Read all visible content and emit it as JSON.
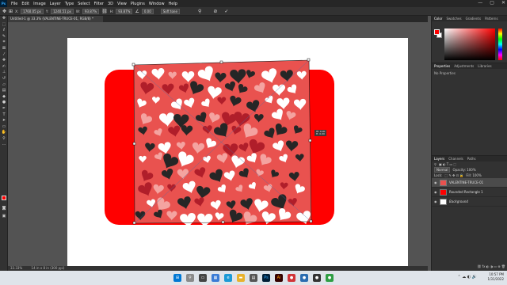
{
  "app": {
    "logo": "Ps",
    "menu": [
      "File",
      "Edit",
      "Image",
      "Layer",
      "Type",
      "Select",
      "Filter",
      "3D",
      "View",
      "Plugins",
      "Window",
      "Help"
    ],
    "window_controls": [
      "—",
      "▢",
      "✕"
    ]
  },
  "options_bar": {
    "x_label": "X:",
    "x_value": "1760.05 px",
    "y_label": "Y:",
    "y_value": "1240.51 px",
    "w_label": "W:",
    "w_value": "93.87%",
    "h_label": "H:",
    "h_value": "93.87%",
    "angle_value": "0.00",
    "interp_label": "Soft tone",
    "cancel_icon": "cancel-icon",
    "commit_icon": "check-icon"
  },
  "document": {
    "tab_title": "Untitled-1 @ 33.3% (VALENTINE-TRUCE-01, RGB/8) *",
    "zoom_status": "33.33%",
    "doc_status": "14 in x 8 in (300 ppi)",
    "transform_readout": "W: 0.00\nH: 0.00"
  },
  "panels": {
    "color_tabs": [
      "Color",
      "Swatches",
      "Gradients",
      "Patterns"
    ],
    "props_tabs": [
      "Properties",
      "Adjustments",
      "Libraries"
    ],
    "props_text": "No Properties",
    "layers_tabs": [
      "Layers",
      "Channels",
      "Paths"
    ],
    "blend_mode": "Normal",
    "opacity_label": "Opacity: 100%",
    "fill_label": "Fill: 100%",
    "lock_label": "Lock:",
    "layers": [
      {
        "name": "VALENTINE-TRUCE-01",
        "selected": true
      },
      {
        "name": "Rounded Rectangle 1",
        "selected": false
      },
      {
        "name": "Background",
        "selected": false
      }
    ]
  },
  "colors": {
    "foreground": "#ff0000",
    "background": "#ffffff",
    "pattern_bg": "#e9524f"
  },
  "taskbar": {
    "time": "10:57 PM",
    "date": "1/31/2022",
    "lang": "ENG"
  }
}
